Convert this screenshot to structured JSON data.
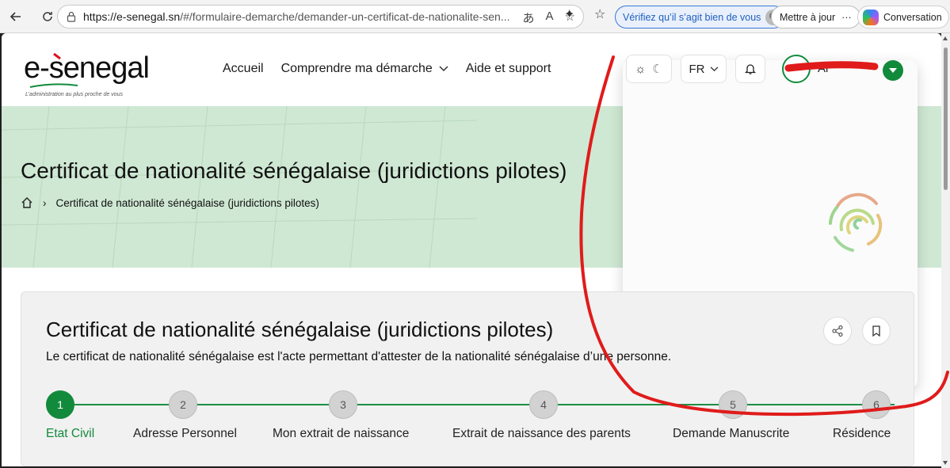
{
  "browser": {
    "url_host": "https://e-senegal.sn",
    "url_path": "/#/formulaire-demarche/demander-un-certificat-de-nationalite-sen...",
    "verify_label": "Vérifiez qu’il s’agit bien de vous",
    "mettre_label": "Mettre à jour",
    "conversation_label": "Conversation"
  },
  "site": {
    "logo_text": "e-senegal",
    "logo_tagline": "L’administration au plus proche de vous",
    "nav": [
      {
        "label": "Accueil"
      },
      {
        "label": "Comprendre ma démarche"
      },
      {
        "label": "Aide et support"
      }
    ],
    "lang": "FR",
    "user_partial": "Al"
  },
  "hero": {
    "title": "Certificat de nationalité sénégalaise (juridictions pilotes)",
    "breadcrumb_current": "Certificat de nationalité sénégalaise (juridictions pilotes)"
  },
  "card": {
    "title": "Certificat de nationalité sénégalaise (juridictions pilotes)",
    "description": "Le certificat de nationalité sénégalaise est l'acte permettant d'attester de la nationalité sénégalaise d’une personne."
  },
  "steps": [
    {
      "num": "1",
      "label": "Etat Civil",
      "active": true
    },
    {
      "num": "2",
      "label": "Adresse Personnel",
      "active": false
    },
    {
      "num": "3",
      "label": "Mon extrait de naissance",
      "active": false
    },
    {
      "num": "4",
      "label": "Extrait de naissance des parents",
      "active": false
    },
    {
      "num": "5",
      "label": "Demande Manuscrite",
      "active": false
    },
    {
      "num": "6",
      "label": "Résidence",
      "active": false
    }
  ],
  "colors": {
    "accent": "#128a3c",
    "hero_bg": "#cfe8d3",
    "annotation": "#e01b1b"
  }
}
